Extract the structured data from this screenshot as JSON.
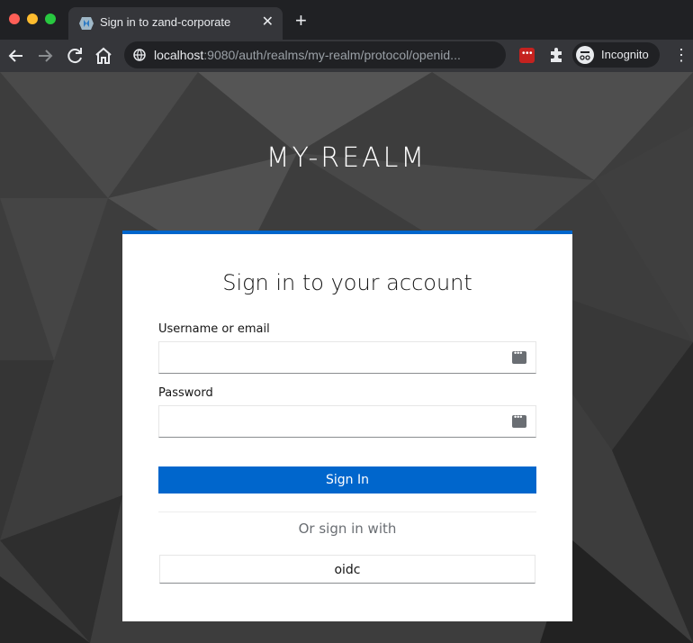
{
  "browser": {
    "tab_title": "Sign in to zand-corporate",
    "url_host": "localhost",
    "url_rest": ":9080/auth/realms/my-realm/protocol/openid...",
    "incognito_label": "Incognito"
  },
  "page": {
    "realm": "MY-REALM",
    "card_title": "Sign in to your account",
    "username_label": "Username or email",
    "username_value": "",
    "password_label": "Password",
    "password_value": "",
    "signin_label": "Sign In",
    "or_text": "Or sign in with",
    "provider_label": "oidc"
  },
  "colors": {
    "accent": "#0066cc",
    "page_bg": "#3a3a3a",
    "card_bg": "#ffffff"
  }
}
